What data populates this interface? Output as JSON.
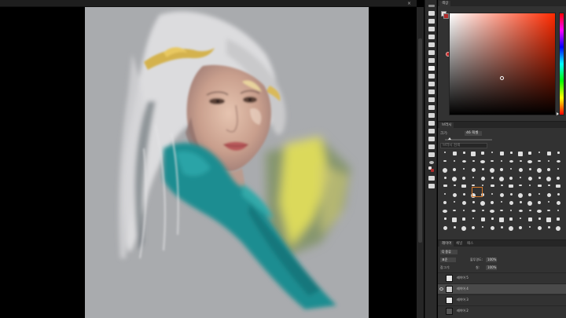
{
  "document": {
    "close_glyph": "×"
  },
  "colors": {
    "foreground": "#e8e2e2",
    "background": "#b12a2a",
    "hue_base": "#ff2a00"
  },
  "panels": {
    "color": {
      "tab_label": "색상"
    },
    "brushes": {
      "tab_label": "브러시",
      "size_label": "크기:",
      "size_value": "46 픽셀",
      "search_placeholder": "브러시 검색"
    },
    "layers": {
      "tabs": [
        "레이어",
        "채널",
        "패스"
      ],
      "filter_value": "Q 종류",
      "blend_mode": "표준",
      "opacity_label": "불투명도:",
      "opacity_value": "100%",
      "lock_label": "잠그기:",
      "fill_label": "칠:",
      "fill_value": "100%",
      "items": [
        {
          "name": "레이어 5"
        },
        {
          "name": "레이어 4"
        },
        {
          "name": "레이어 3"
        },
        {
          "name": "레이어 2"
        }
      ]
    }
  }
}
